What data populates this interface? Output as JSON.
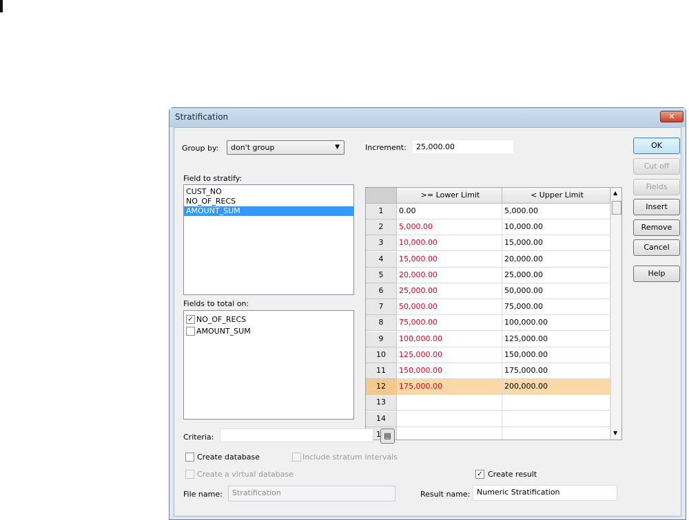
{
  "window": {
    "title": "Stratification",
    "close_label": "✕"
  },
  "group_by": {
    "label": "Group by:",
    "value": "don't group"
  },
  "increment": {
    "label": "Increment:",
    "value": "25,000.00"
  },
  "field_to_stratify": {
    "label": "Field to stratify:",
    "items": [
      "CUST_NO",
      "NO_OF_RECS",
      "AMOUNT_SUM"
    ],
    "selected": "AMOUNT_SUM"
  },
  "fields_to_total": {
    "label": "Fields to total on:",
    "items": [
      {
        "label": "NO_OF_RECS",
        "checked": true
      },
      {
        "label": "AMOUNT_SUM",
        "checked": false
      }
    ]
  },
  "grid": {
    "headers": [
      "",
      ">= Lower Limit",
      "< Upper Limit"
    ],
    "highlighted_row": "12",
    "rows": [
      [
        "1",
        "0.00",
        "5,000.00"
      ],
      [
        "2",
        "5,000.00",
        "10,000.00"
      ],
      [
        "3",
        "10,000.00",
        "15,000.00"
      ],
      [
        "4",
        "15,000.00",
        "20,000.00"
      ],
      [
        "5",
        "20,000.00",
        "25,000.00"
      ],
      [
        "6",
        "25,000.00",
        "50,000.00"
      ],
      [
        "7",
        "50,000.00",
        "75,000.00"
      ],
      [
        "8",
        "75,000.00",
        "100,000.00"
      ],
      [
        "9",
        "100,000.00",
        "125,000.00"
      ],
      [
        "10",
        "125,000.00",
        "150,000.00"
      ],
      [
        "11",
        "150,000.00",
        "175,000.00"
      ],
      [
        "12",
        "175,000.00",
        "200,000.00"
      ],
      [
        "13",
        "",
        ""
      ],
      [
        "14",
        "",
        ""
      ],
      [
        "15",
        "",
        ""
      ]
    ],
    "lower_limit_color": "#e4001b"
  },
  "buttons": {
    "ok": "OK",
    "cut_off": "Cut off",
    "fields": "Fields",
    "insert": "Insert",
    "remove": "Remove",
    "cancel": "Cancel",
    "help": "Help"
  },
  "criteria": {
    "label": "Criteria:",
    "value": ""
  },
  "options": {
    "create_database": "Create database",
    "include_stratum": "Include stratum intervals",
    "virtual_db": "Create a virtual database",
    "create_result": "Create result",
    "create_result_checked": true
  },
  "file_name": {
    "label": "File name:",
    "value": "Stratification"
  },
  "result_name": {
    "label": "Result name:",
    "value": "Numeric Stratification"
  }
}
